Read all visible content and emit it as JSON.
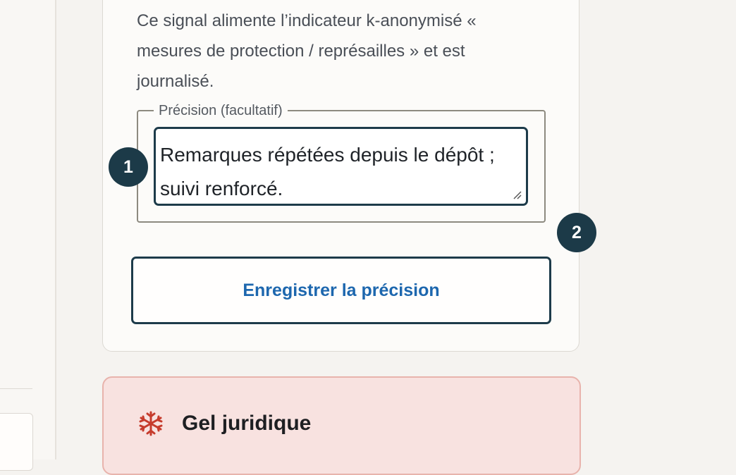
{
  "signal": {
    "description": "Ce signal alimente l’indicateur k-anonymisé « mesures de protection / représailles » et est journalisé.",
    "precision_legend": "Précision (facultatif)",
    "precision_value": "Remarques répétées depuis le dépôt ; suivi renforcé.",
    "save_label": "Enregistrer la précision"
  },
  "steps": {
    "step1": "1",
    "step2": "2"
  },
  "legal": {
    "title": "Gel juridique",
    "icon": "snowflake-icon",
    "accent": "#c63b2c"
  },
  "colors": {
    "primary_dark": "#1c3a48",
    "link_blue": "#1d67ae",
    "legal_bg": "#f8e2e0"
  }
}
